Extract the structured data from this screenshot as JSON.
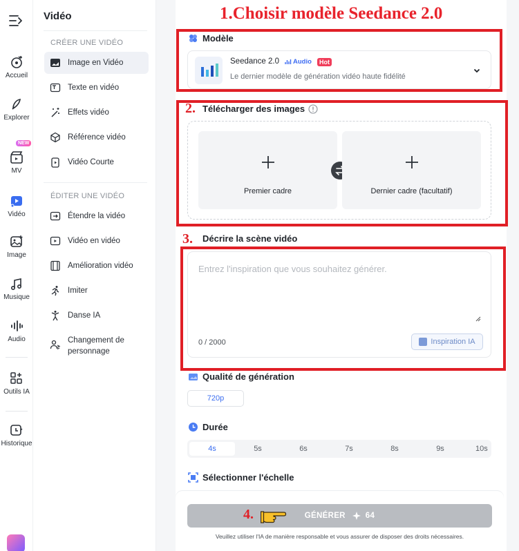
{
  "rail": {
    "items": [
      {
        "label": "Accueil",
        "icon": "home-icon"
      },
      {
        "label": "Explorer",
        "icon": "compass-icon"
      },
      {
        "label": "MV",
        "icon": "clapperboard-icon",
        "badge": "NEW"
      },
      {
        "label": "Vidéo",
        "icon": "video-icon"
      },
      {
        "label": "Image",
        "icon": "image-icon"
      },
      {
        "label": "Musique",
        "icon": "music-icon"
      },
      {
        "label": "Audio",
        "icon": "audio-wave-icon"
      },
      {
        "label": "Outils IA",
        "icon": "tools-grid-icon"
      },
      {
        "label": "Historique",
        "icon": "history-icon"
      }
    ],
    "active": "Vidéo"
  },
  "menu": {
    "title": "Vidéo",
    "section_create": "CRÉER UNE VIDÉO",
    "create_items": [
      {
        "label": "Image en Vidéo",
        "icon": "image-video-icon"
      },
      {
        "label": "Texte en vidéo",
        "icon": "text-video-icon"
      },
      {
        "label": "Effets vidéo",
        "icon": "magic-wand-icon"
      },
      {
        "label": "Référence vidéo",
        "icon": "cube-icon"
      },
      {
        "label": "Vidéo Courte",
        "icon": "short-video-icon"
      }
    ],
    "section_edit": "ÉDITER UNE VIDÉO",
    "edit_items": [
      {
        "label": "Étendre la vidéo",
        "icon": "extend-icon"
      },
      {
        "label": "Vidéo en vidéo",
        "icon": "video-to-video-icon"
      },
      {
        "label": "Amélioration vidéo",
        "icon": "film-enhance-icon"
      },
      {
        "label": "Imiter",
        "icon": "running-person-icon"
      },
      {
        "label": "Danse IA",
        "icon": "dance-icon"
      },
      {
        "label": "Changement de personnage",
        "icon": "character-swap-icon"
      }
    ],
    "active": "Image en Vidéo"
  },
  "annotations": {
    "banner": "1.Choisir modèle Seedance 2.0",
    "step2": "2.",
    "step3": "3.",
    "step4": "4."
  },
  "model": {
    "section_label": "Modèle",
    "name": "Seedance 2.0",
    "audio_tag": "Audio",
    "hot_tag": "Hot",
    "description": "Le dernier modèle de génération vidéo haute fidélité"
  },
  "upload": {
    "section_label": "Télécharger des images",
    "first_frame": "Premier cadre",
    "last_frame": "Dernier cadre (facultatif)"
  },
  "prompt": {
    "section_label": "Décrire la scène vidéo",
    "placeholder": "Entrez l'inspiration que vous souhaitez générer.",
    "counter": "0 / 2000",
    "inspire_button": "Inspiration IA"
  },
  "quality": {
    "section_label": "Qualité de génération",
    "selected": "720p"
  },
  "duration": {
    "section_label": "Durée",
    "options": [
      "4s",
      "5s",
      "6s",
      "7s",
      "8s",
      "9s",
      "10s"
    ],
    "selected": "4s"
  },
  "scale": {
    "section_label": "Sélectionner l'échelle"
  },
  "generate": {
    "label": "GÉNÉRER",
    "cost": "64",
    "note": "Veuillez utiliser l'IA de manière responsable et vous assurer de disposer des droits nécessaires."
  },
  "colors": {
    "accent": "#3a6df0",
    "annotation_red": "#e01f26",
    "hot": "#f03d5a",
    "disabled_button": "#b9bcc1"
  }
}
